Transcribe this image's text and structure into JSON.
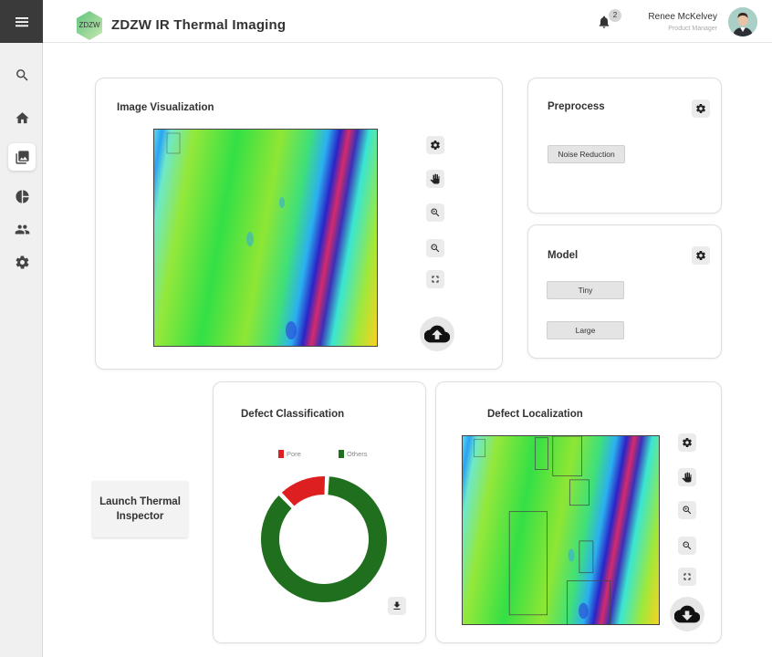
{
  "header": {
    "logo_text": "ZDZW",
    "app_title": "ZDZW IR Thermal Imaging",
    "notification_count": "2",
    "user_name": "Renee McKelvey",
    "user_role": "Product Manager"
  },
  "sidebar": {
    "items": [
      {
        "icon": "search-icon"
      },
      {
        "icon": "home-icon"
      },
      {
        "icon": "gallery-icon",
        "active": true
      },
      {
        "icon": "pie-chart-icon"
      },
      {
        "icon": "users-icon"
      },
      {
        "icon": "gear-icon"
      }
    ]
  },
  "image_visualization": {
    "title": "Image Visualization",
    "tools": [
      "settings-icon",
      "pan-hand-icon",
      "zoom-in-icon",
      "zoom-out-icon",
      "fullscreen-icon"
    ],
    "upload_icon": "cloud-upload-icon"
  },
  "preprocess": {
    "title": "Preprocess",
    "noise_reduction_label": "Noise Reduction"
  },
  "model": {
    "title": "Model",
    "tiny_label": "Tiny",
    "large_label": "Large"
  },
  "launch": {
    "label": "Launch Thermal Inspector"
  },
  "defect_classification": {
    "title": "Defect Classification",
    "download_icon": "download-icon"
  },
  "defect_localization": {
    "title": "Defect Localization",
    "tools": [
      "settings-icon",
      "pan-hand-icon",
      "zoom-in-icon",
      "zoom-out-icon",
      "fullscreen-icon"
    ],
    "download_icon": "cloud-download-icon"
  },
  "chart_data": {
    "type": "pie",
    "donut": true,
    "categories": [
      "Pore",
      "Others"
    ],
    "values": [
      13,
      87
    ],
    "colors": [
      "#dd1f1f",
      "#1f6f1f"
    ],
    "legend_position": "top"
  },
  "colors": {
    "sidebar_active_bg": "#ffffff",
    "menu_bg": "#3a3a3a",
    "pore": "#dd1f1f",
    "others": "#1f6f1f"
  }
}
